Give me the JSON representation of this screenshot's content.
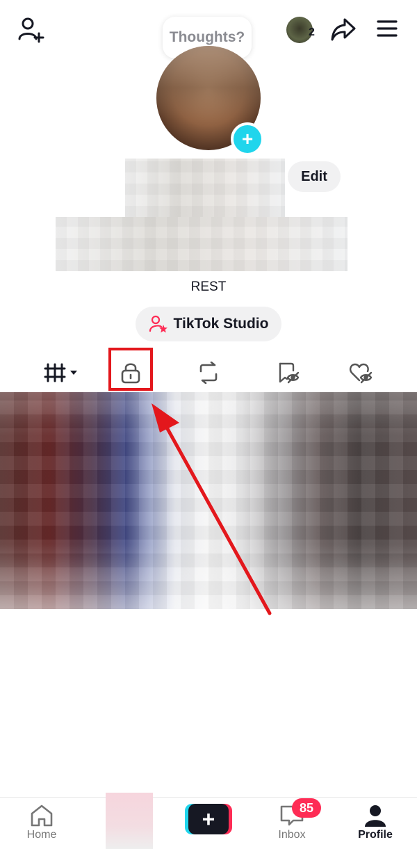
{
  "header": {
    "thoughts_bubble": "Thoughts?",
    "notification_count": "2"
  },
  "profile": {
    "edit_label": "Edit",
    "bio": "REST",
    "studio_label": "TikTok Studio"
  },
  "tabs": [
    {
      "name": "videos-grid",
      "icon": "grid-icon"
    },
    {
      "name": "private",
      "icon": "lock-icon"
    },
    {
      "name": "reposts",
      "icon": "repost-icon"
    },
    {
      "name": "favorites",
      "icon": "bookmark-hidden-icon"
    },
    {
      "name": "liked",
      "icon": "heart-hidden-icon"
    }
  ],
  "nav": {
    "home": "Home",
    "inbox": "Inbox",
    "inbox_badge": "85",
    "profile": "Profile"
  },
  "colors": {
    "accent_cyan": "#20d5ec",
    "accent_pink": "#fe2c55",
    "highlight_red": "#e3171c"
  }
}
